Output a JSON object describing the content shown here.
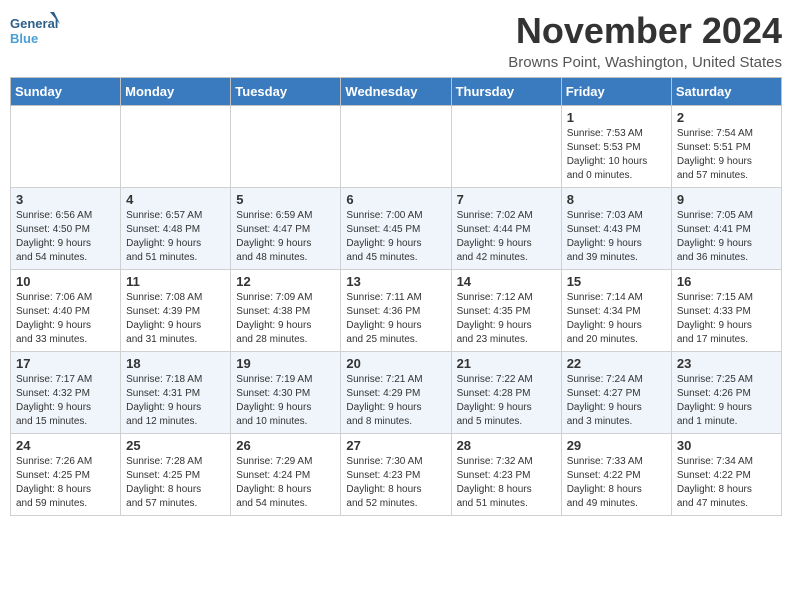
{
  "logo": {
    "line1": "General",
    "line2": "Blue"
  },
  "header": {
    "month_year": "November 2024",
    "location": "Browns Point, Washington, United States"
  },
  "weekdays": [
    "Sunday",
    "Monday",
    "Tuesday",
    "Wednesday",
    "Thursday",
    "Friday",
    "Saturday"
  ],
  "weeks": [
    [
      {
        "day": "",
        "info": ""
      },
      {
        "day": "",
        "info": ""
      },
      {
        "day": "",
        "info": ""
      },
      {
        "day": "",
        "info": ""
      },
      {
        "day": "",
        "info": ""
      },
      {
        "day": "1",
        "info": "Sunrise: 7:53 AM\nSunset: 5:53 PM\nDaylight: 10 hours\nand 0 minutes."
      },
      {
        "day": "2",
        "info": "Sunrise: 7:54 AM\nSunset: 5:51 PM\nDaylight: 9 hours\nand 57 minutes."
      }
    ],
    [
      {
        "day": "3",
        "info": "Sunrise: 6:56 AM\nSunset: 4:50 PM\nDaylight: 9 hours\nand 54 minutes."
      },
      {
        "day": "4",
        "info": "Sunrise: 6:57 AM\nSunset: 4:48 PM\nDaylight: 9 hours\nand 51 minutes."
      },
      {
        "day": "5",
        "info": "Sunrise: 6:59 AM\nSunset: 4:47 PM\nDaylight: 9 hours\nand 48 minutes."
      },
      {
        "day": "6",
        "info": "Sunrise: 7:00 AM\nSunset: 4:45 PM\nDaylight: 9 hours\nand 45 minutes."
      },
      {
        "day": "7",
        "info": "Sunrise: 7:02 AM\nSunset: 4:44 PM\nDaylight: 9 hours\nand 42 minutes."
      },
      {
        "day": "8",
        "info": "Sunrise: 7:03 AM\nSunset: 4:43 PM\nDaylight: 9 hours\nand 39 minutes."
      },
      {
        "day": "9",
        "info": "Sunrise: 7:05 AM\nSunset: 4:41 PM\nDaylight: 9 hours\nand 36 minutes."
      }
    ],
    [
      {
        "day": "10",
        "info": "Sunrise: 7:06 AM\nSunset: 4:40 PM\nDaylight: 9 hours\nand 33 minutes."
      },
      {
        "day": "11",
        "info": "Sunrise: 7:08 AM\nSunset: 4:39 PM\nDaylight: 9 hours\nand 31 minutes."
      },
      {
        "day": "12",
        "info": "Sunrise: 7:09 AM\nSunset: 4:38 PM\nDaylight: 9 hours\nand 28 minutes."
      },
      {
        "day": "13",
        "info": "Sunrise: 7:11 AM\nSunset: 4:36 PM\nDaylight: 9 hours\nand 25 minutes."
      },
      {
        "day": "14",
        "info": "Sunrise: 7:12 AM\nSunset: 4:35 PM\nDaylight: 9 hours\nand 23 minutes."
      },
      {
        "day": "15",
        "info": "Sunrise: 7:14 AM\nSunset: 4:34 PM\nDaylight: 9 hours\nand 20 minutes."
      },
      {
        "day": "16",
        "info": "Sunrise: 7:15 AM\nSunset: 4:33 PM\nDaylight: 9 hours\nand 17 minutes."
      }
    ],
    [
      {
        "day": "17",
        "info": "Sunrise: 7:17 AM\nSunset: 4:32 PM\nDaylight: 9 hours\nand 15 minutes."
      },
      {
        "day": "18",
        "info": "Sunrise: 7:18 AM\nSunset: 4:31 PM\nDaylight: 9 hours\nand 12 minutes."
      },
      {
        "day": "19",
        "info": "Sunrise: 7:19 AM\nSunset: 4:30 PM\nDaylight: 9 hours\nand 10 minutes."
      },
      {
        "day": "20",
        "info": "Sunrise: 7:21 AM\nSunset: 4:29 PM\nDaylight: 9 hours\nand 8 minutes."
      },
      {
        "day": "21",
        "info": "Sunrise: 7:22 AM\nSunset: 4:28 PM\nDaylight: 9 hours\nand 5 minutes."
      },
      {
        "day": "22",
        "info": "Sunrise: 7:24 AM\nSunset: 4:27 PM\nDaylight: 9 hours\nand 3 minutes."
      },
      {
        "day": "23",
        "info": "Sunrise: 7:25 AM\nSunset: 4:26 PM\nDaylight: 9 hours\nand 1 minute."
      }
    ],
    [
      {
        "day": "24",
        "info": "Sunrise: 7:26 AM\nSunset: 4:25 PM\nDaylight: 8 hours\nand 59 minutes."
      },
      {
        "day": "25",
        "info": "Sunrise: 7:28 AM\nSunset: 4:25 PM\nDaylight: 8 hours\nand 57 minutes."
      },
      {
        "day": "26",
        "info": "Sunrise: 7:29 AM\nSunset: 4:24 PM\nDaylight: 8 hours\nand 54 minutes."
      },
      {
        "day": "27",
        "info": "Sunrise: 7:30 AM\nSunset: 4:23 PM\nDaylight: 8 hours\nand 52 minutes."
      },
      {
        "day": "28",
        "info": "Sunrise: 7:32 AM\nSunset: 4:23 PM\nDaylight: 8 hours\nand 51 minutes."
      },
      {
        "day": "29",
        "info": "Sunrise: 7:33 AM\nSunset: 4:22 PM\nDaylight: 8 hours\nand 49 minutes."
      },
      {
        "day": "30",
        "info": "Sunrise: 7:34 AM\nSunset: 4:22 PM\nDaylight: 8 hours\nand 47 minutes."
      }
    ]
  ]
}
